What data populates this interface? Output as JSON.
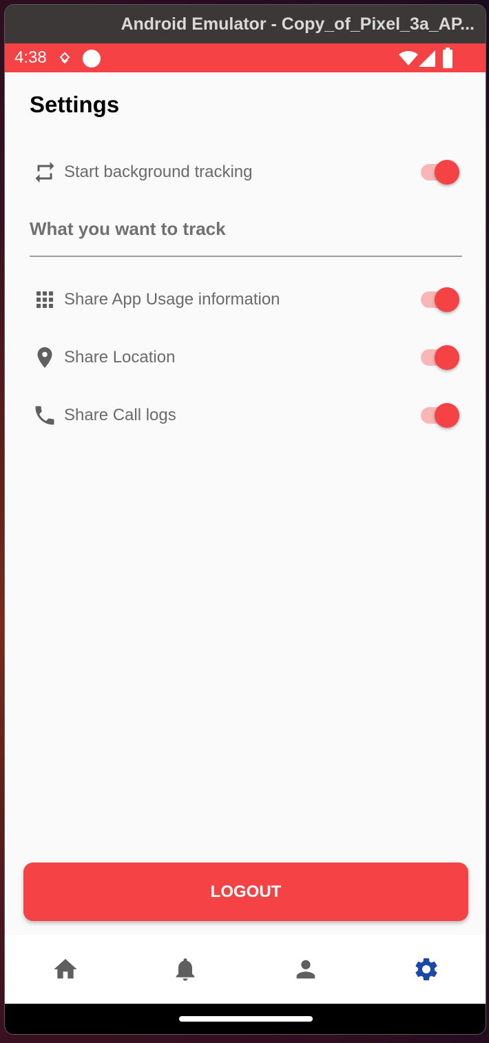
{
  "window": {
    "title": "Android Emulator - Copy_of_Pixel_3a_AP..."
  },
  "status_bar": {
    "time": "4:38",
    "icons": [
      "assistant-icon",
      "record-dot-icon",
      "wifi-icon",
      "signal-icon",
      "battery-icon"
    ],
    "background": "#f54244"
  },
  "page": {
    "title": "Settings"
  },
  "settings": {
    "background_tracking": {
      "label": "Start background tracking",
      "icon": "repeat-icon",
      "enabled": true
    },
    "section_title": "What you want to track",
    "items": [
      {
        "label": "Share App Usage information",
        "icon": "apps-grid-icon",
        "enabled": true
      },
      {
        "label": "Share Location",
        "icon": "location-pin-icon",
        "enabled": true
      },
      {
        "label": "Share Call logs",
        "icon": "phone-icon",
        "enabled": true
      }
    ]
  },
  "logout": {
    "label": "LOGOUT"
  },
  "bottom_nav": {
    "items": [
      {
        "icon": "home-icon",
        "active": false
      },
      {
        "icon": "bell-icon",
        "active": false
      },
      {
        "icon": "person-icon",
        "active": false
      },
      {
        "icon": "gear-icon",
        "active": true
      }
    ],
    "active_color": "#1a47a8",
    "inactive_color": "#5f5f5f"
  },
  "colors": {
    "accent": "#f54244",
    "switch_track": "#f9b6b6"
  }
}
